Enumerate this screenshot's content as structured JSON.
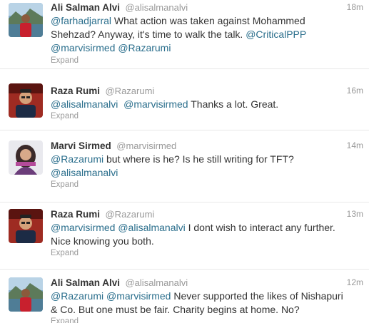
{
  "tweets": [
    {
      "fullname": "Ali Salman Alvi",
      "username": "@alisalmanalvi",
      "time": "18m",
      "mentions_a": [
        "@farhadjarral"
      ],
      "text_a": " What action was taken against Mohammed Shehzad? Anyway, it's time to walk the talk. ",
      "mentions_b": [
        "@CriticalPPP",
        "@marvisirmed",
        "@Razarumi"
      ],
      "expand": "Expand"
    },
    {
      "fullname": "Raza Rumi",
      "username": "@Razarumi",
      "time": "16m",
      "mentions_a": [
        "@alisalmanalvi",
        "@marvisirmed"
      ],
      "text_a": " Thanks a lot. Great.",
      "expand": "Expand"
    },
    {
      "fullname": "Marvi Sirmed",
      "username": "@marvisirmed",
      "time": "14m",
      "mentions_a": [
        "@Razarumi"
      ],
      "text_a": " but where is he? Is he still writing for TFT? ",
      "mentions_b": [
        "@alisalmanalvi"
      ],
      "expand": "Expand"
    },
    {
      "fullname": "Raza Rumi",
      "username": "@Razarumi",
      "time": "13m",
      "mentions_a": [
        "@marvisirmed",
        "@alisalmanalvi"
      ],
      "text_a": " I dont wish to interact any further. Nice knowing you both.",
      "expand": "Expand"
    },
    {
      "fullname": "Ali Salman Alvi",
      "username": "@alisalmanalvi",
      "time": "12m",
      "mentions_a": [
        "@Razarumi",
        "@marvisirmed"
      ],
      "text_a": " Never supported the likes of Nishapuri & Co. But one must be fair. Charity begins at home. No?",
      "expand": "Expand"
    }
  ],
  "colors": {
    "mention": "#2a6e8c",
    "meta": "#999999",
    "text": "#333333"
  },
  "icons": [
    "avatar-ali-salman-alvi",
    "avatar-raza-rumi",
    "avatar-marvi-sirmed"
  ]
}
